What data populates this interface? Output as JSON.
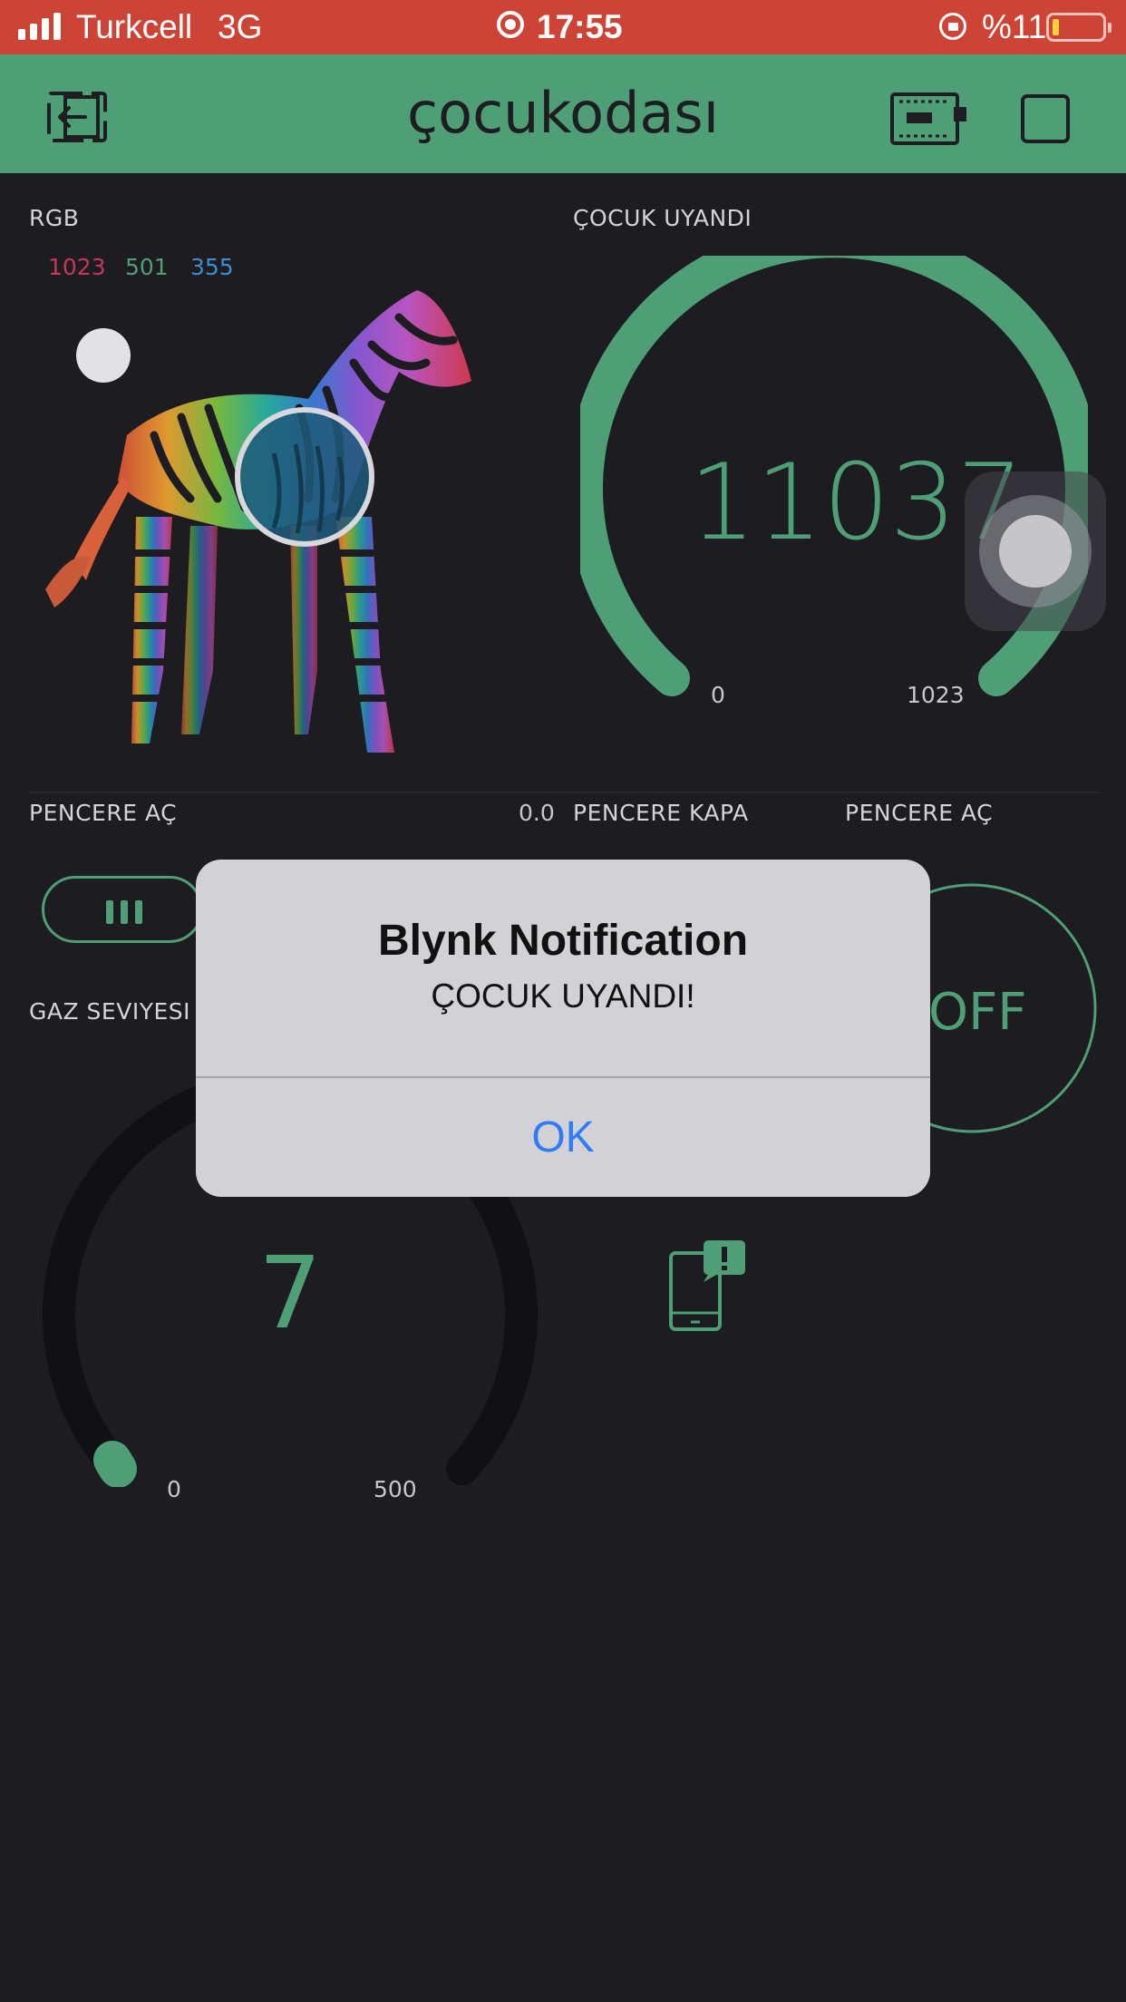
{
  "status_bar": {
    "carrier": "Turkcell",
    "network": "3G",
    "time": "17:55",
    "battery": "%11"
  },
  "header": {
    "title": "çocukodası"
  },
  "widgets": {
    "rgb": {
      "label": "RGB",
      "r": "1023",
      "g": "501",
      "b": "355",
      "r_color": "#c8365b",
      "g_color": "#4f9f76",
      "b_color": "#3b8fd0"
    },
    "gauge_cocuk": {
      "label": "ÇOCUK UYANDI",
      "value": "11037",
      "min": "0",
      "max": "1023"
    },
    "pencere_ac_slider": {
      "label": "PENCERE AÇ",
      "value": "0.0"
    },
    "pencere_kapa": {
      "label": "PENCERE KAPA"
    },
    "pencere_ac_button": {
      "label": "PENCERE AÇ",
      "state": "OFF"
    },
    "gaz_seviyesi": {
      "label": "GAZ SEVIYESI",
      "value": "7",
      "min": "0",
      "max": "500"
    }
  },
  "dialog": {
    "title": "Blynk Notification",
    "message": "ÇOCUK UYANDI!",
    "ok": "OK"
  },
  "colors": {
    "accent": "#4f9f76",
    "status_bar": "#cd4436",
    "background": "#1c1c21"
  }
}
